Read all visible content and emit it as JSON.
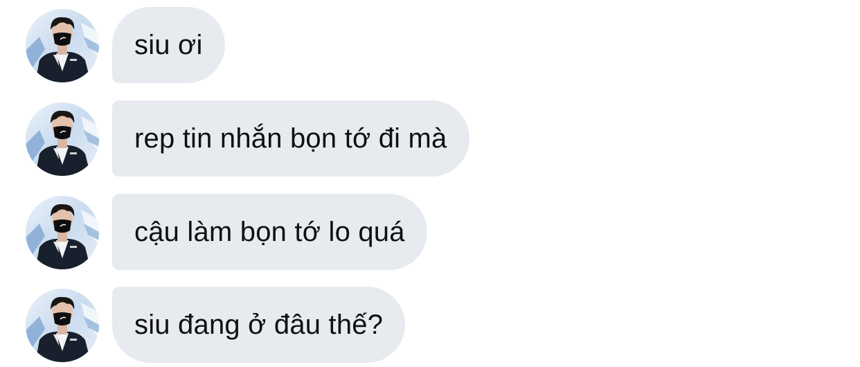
{
  "conversation": {
    "sender_avatar_icon": "profile-photo-person-in-black-mask",
    "messages": [
      {
        "text": "siu ơi"
      },
      {
        "text": "rep tin nhắn bọn tớ đi mà"
      },
      {
        "text": "cậu làm bọn tớ lo quá"
      },
      {
        "text": "siu đang ở đâu thế?"
      }
    ]
  },
  "colors": {
    "bubble_background": "#e7eaef",
    "text": "#101010",
    "page_background": "#ffffff"
  }
}
